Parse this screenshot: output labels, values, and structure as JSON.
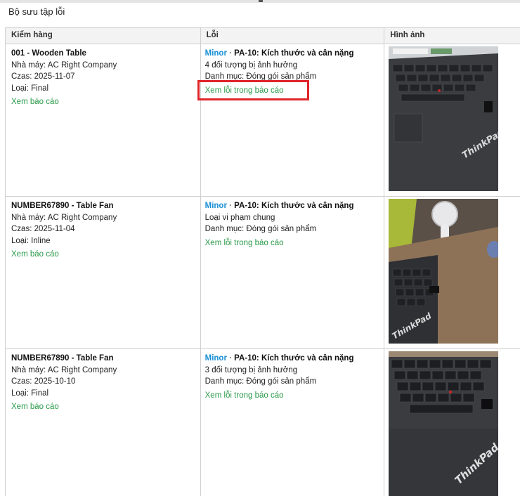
{
  "page_title": "Bộ sưu tập lỗi",
  "table": {
    "headers": [
      "Kiểm hàng",
      "Lỗi",
      "Hình ảnh"
    ],
    "rows": [
      {
        "title": "001 - Wooden Table",
        "factory": "Nhà máy: AC Right Company",
        "date": "Czas: 2025-11-07",
        "type": "Loại: Final",
        "report_link": "Xem báo cáo",
        "severity": "Minor",
        "sep": " · ",
        "defect": "PA-10: Kích thước và cân nặng",
        "affected": "4 đối tượng bị ảnh hưởng",
        "category": "Danh mục: Đóng gói sản phẩm",
        "defect_link": "Xem lỗi trong báo cáo",
        "image_brand": "ThinkPad"
      },
      {
        "title": "NUMBER67890 - Table Fan",
        "factory": "Nhà máy: AC Right Company",
        "date": "Czas: 2025-11-04",
        "type": "Loại: Inline",
        "report_link": "Xem báo cáo",
        "severity": "Minor",
        "sep": " · ",
        "defect": "PA-10: Kích thước và cân nặng",
        "affected": "Loại vi phạm chung",
        "category": "Danh mục: Đóng gói sản phẩm",
        "defect_link": "Xem lỗi trong báo cáo",
        "image_brand": "ThinkPad"
      },
      {
        "title": "NUMBER67890 - Table Fan",
        "factory": "Nhà máy: AC Right Company",
        "date": "Czas: 2025-10-10",
        "type": "Loại: Final",
        "report_link": "Xem báo cáo",
        "severity": "Minor",
        "sep": " · ",
        "defect": "PA-10: Kích thước và cân nặng",
        "affected": "3 đối tượng bị ảnh hưởng",
        "category": "Danh mục: Đóng gói sản phẩm",
        "defect_link": "Xem lỗi trong báo cáo",
        "image_brand": "ThinkPad"
      }
    ]
  },
  "colors": {
    "link": "#2a9a4a",
    "severity": "#1a90d4",
    "highlight": "#e0242a"
  }
}
